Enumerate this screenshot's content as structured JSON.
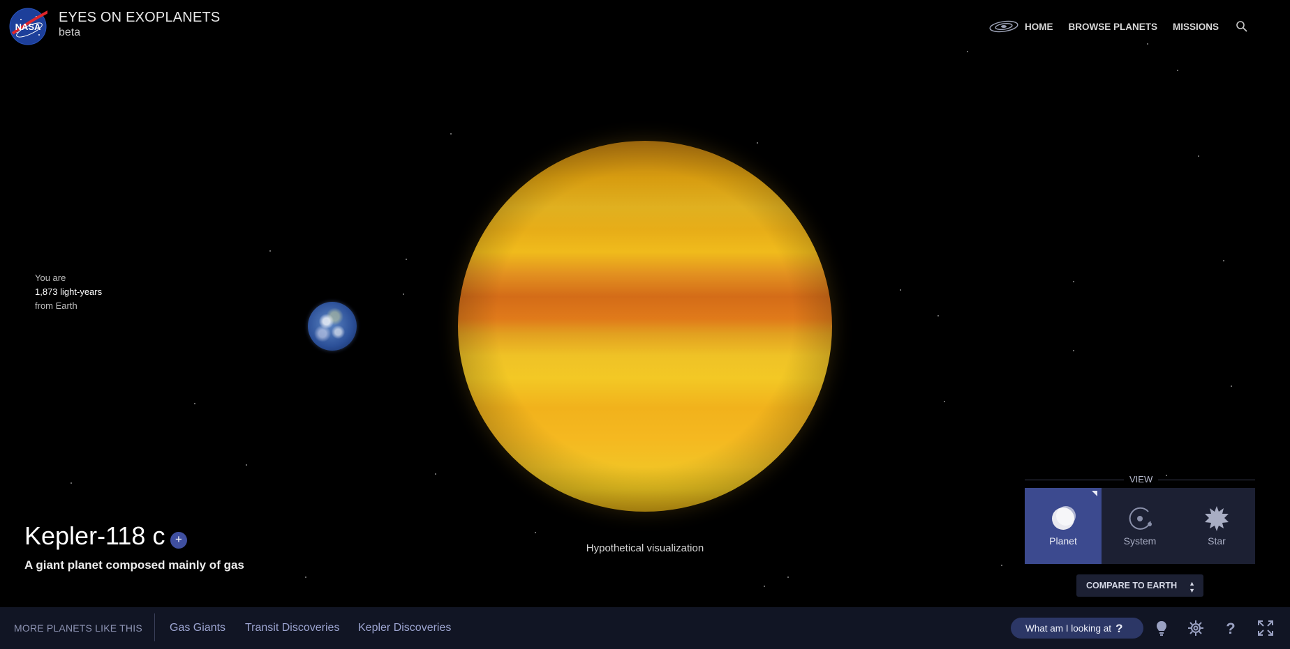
{
  "header": {
    "logo_text": "NASA",
    "title": "EYES ON EXOPLANETS",
    "subtitle": "beta",
    "nav": [
      "HOME",
      "BROWSE PLANETS",
      "MISSIONS"
    ]
  },
  "distance": {
    "line1": "You are",
    "value": "1,873 light-years",
    "line3": "from Earth"
  },
  "planet": {
    "name": "Kepler-118 c",
    "description": "A giant planet composed mainly of gas",
    "add_label": "+"
  },
  "visualization_note": "Hypothetical visualization",
  "view": {
    "label": "VIEW",
    "options": [
      "Planet",
      "System",
      "Star"
    ],
    "active": "Planet"
  },
  "compare_label": "COMPARE TO EARTH",
  "bottom": {
    "more_label": "MORE PLANETS LIKE THIS",
    "links": [
      "Gas Giants",
      "Transit Discoveries",
      "Kepler Discoveries"
    ],
    "help_pill": "What am I looking at",
    "help_pill_icon": "?"
  },
  "icons": [
    "nasa-logo",
    "galaxy-icon",
    "search-icon",
    "planet-icon",
    "system-icon",
    "star-icon",
    "lightbulb-icon",
    "gear-icon",
    "help-icon",
    "fullscreen-icon"
  ],
  "colors": {
    "background": "#000000",
    "accent": "#3c4a8f",
    "bottom_bar": "#111524",
    "link": "#9ca4d0"
  }
}
